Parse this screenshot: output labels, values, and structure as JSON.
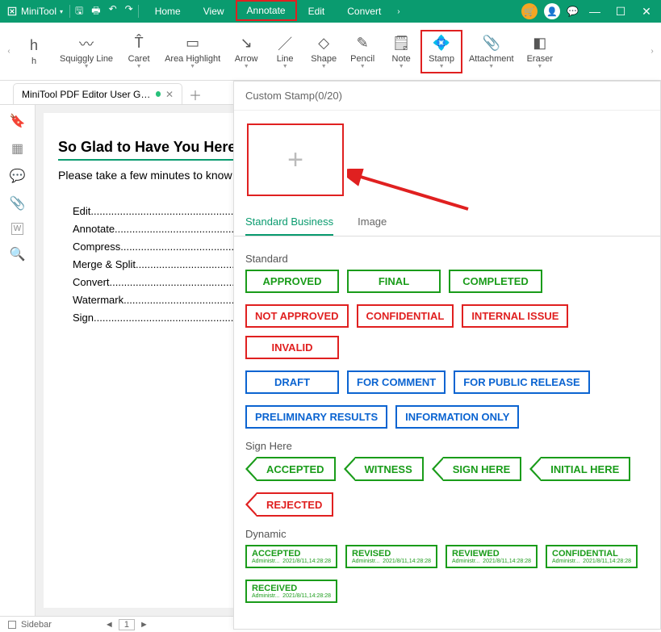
{
  "app": {
    "name": "MiniTool"
  },
  "menus": [
    "Home",
    "View",
    "Annotate",
    "Edit",
    "Convert"
  ],
  "active_menu": 2,
  "ribbon": [
    {
      "icon": "h",
      "label": "h",
      "drop": false
    },
    {
      "icon": "〰",
      "label": "Squiggly Line",
      "drop": true
    },
    {
      "icon": "T̂",
      "label": "Caret",
      "drop": true
    },
    {
      "icon": "▭",
      "label": "Area Highlight",
      "drop": true
    },
    {
      "icon": "↘",
      "label": "Arrow",
      "drop": true
    },
    {
      "icon": "／",
      "label": "Line",
      "drop": true
    },
    {
      "icon": "◇",
      "label": "Shape",
      "drop": true
    },
    {
      "icon": "✎",
      "label": "Pencil",
      "drop": true
    },
    {
      "icon": "🗒",
      "label": "Note",
      "drop": true
    },
    {
      "icon": "💠",
      "label": "Stamp",
      "drop": true,
      "hl": true
    },
    {
      "icon": "📎",
      "label": "Attachment",
      "drop": true
    },
    {
      "icon": "◧",
      "label": "Eraser",
      "drop": true
    }
  ],
  "tab": {
    "title": "MiniTool PDF Editor User Guid..."
  },
  "doc": {
    "heading": "So Glad to Have You Here at M",
    "sub": "Please take a few minutes to know how",
    "toc": [
      "Edit",
      "Annotate",
      "Compress",
      "Merge & Split",
      "Convert",
      "Watermark",
      "Sign"
    ]
  },
  "status": {
    "sidebar": "Sidebar",
    "page": "1"
  },
  "panel": {
    "title": "Custom Stamp(0/20)",
    "tabs": [
      "Standard Business",
      "Image"
    ],
    "active_tab": 0,
    "sections": {
      "standard": {
        "title": "Standard",
        "rows": [
          [
            {
              "t": "APPROVED",
              "c": "g"
            },
            {
              "t": "FINAL",
              "c": "g"
            },
            {
              "t": "COMPLETED",
              "c": "g"
            }
          ],
          [
            {
              "t": "NOT APPROVED",
              "c": "r"
            },
            {
              "t": "CONFIDENTIAL",
              "c": "r"
            },
            {
              "t": "INTERNAL ISSUE",
              "c": "r"
            },
            {
              "t": "INVALID",
              "c": "r"
            }
          ],
          [
            {
              "t": "DRAFT",
              "c": "b"
            },
            {
              "t": "FOR COMMENT",
              "c": "b"
            },
            {
              "t": "FOR PUBLIC RELEASE",
              "c": "b"
            }
          ],
          [
            {
              "t": "PRELIMINARY RESULTS",
              "c": "b"
            },
            {
              "t": "INFORMATION ONLY",
              "c": "b"
            }
          ]
        ]
      },
      "sign": {
        "title": "Sign Here",
        "rows": [
          [
            {
              "t": "ACCEPTED",
              "c": "g"
            },
            {
              "t": "WITNESS",
              "c": "g"
            },
            {
              "t": "SIGN HERE",
              "c": "g"
            },
            {
              "t": "INITIAL HERE",
              "c": "g"
            }
          ],
          [
            {
              "t": "REJECTED",
              "c": "r"
            }
          ]
        ]
      },
      "dynamic": {
        "title": "Dynamic",
        "meta": {
          "user": "Administr...",
          "date": "2021/8/11,14:28:28"
        },
        "rows": [
          [
            "ACCEPTED",
            "REVISED",
            "REVIEWED",
            "CONFIDENTIAL"
          ],
          [
            "RECEIVED"
          ]
        ]
      }
    }
  }
}
